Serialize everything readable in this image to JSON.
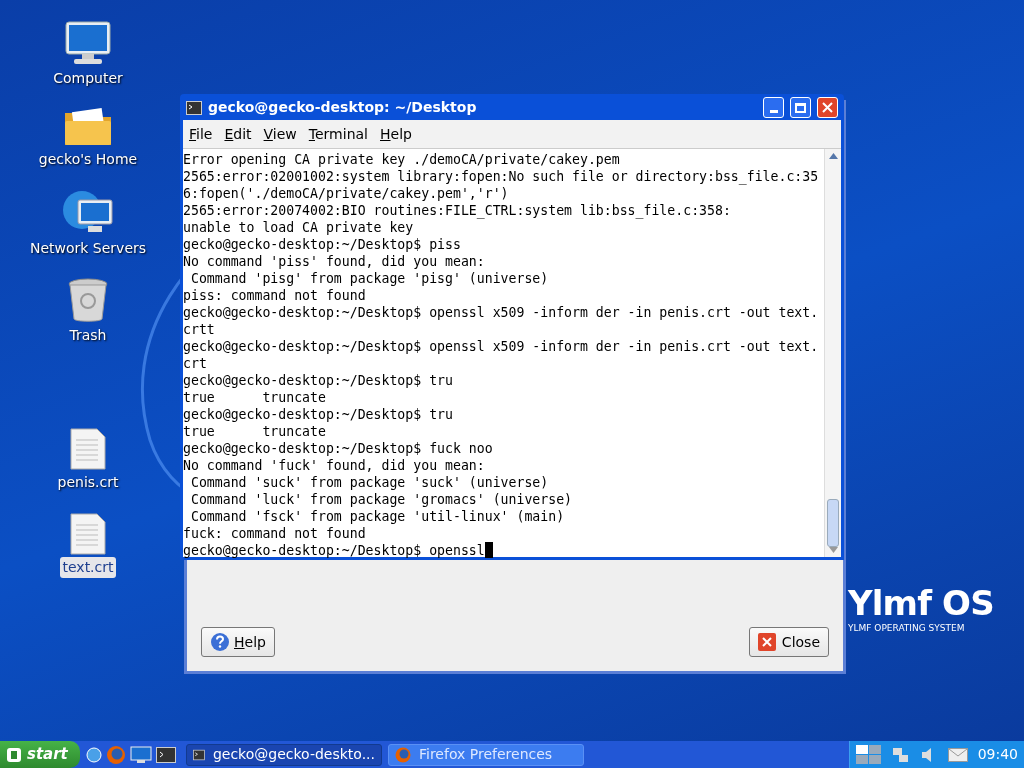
{
  "desktop_icons": [
    {
      "kind": "computer",
      "label": "Computer",
      "selected": false
    },
    {
      "kind": "folder",
      "label": "gecko's Home",
      "selected": false
    },
    {
      "kind": "network",
      "label": "Network Servers",
      "selected": false
    },
    {
      "kind": "trash",
      "label": "Trash",
      "selected": false
    },
    {
      "kind": "file",
      "label": "penis.crt",
      "selected": false
    },
    {
      "kind": "file",
      "label": "text.crt",
      "selected": true
    }
  ],
  "terminal": {
    "title": "gecko@gecko-desktop: ~/Desktop",
    "menu": [
      "File",
      "Edit",
      "View",
      "Terminal",
      "Help"
    ],
    "lines": [
      "Error opening CA private key ./demoCA/private/cakey.pem",
      "2565:error:02001002:system library:fopen:No such file or directory:bss_file.c:35",
      "6:fopen('./demoCA/private/cakey.pem','r')",
      "2565:error:20074002:BIO routines:FILE_CTRL:system lib:bss_file.c:358:",
      "unable to load CA private key",
      "gecko@gecko-desktop:~/Desktop$ piss",
      "No command 'piss' found, did you mean:",
      " Command 'pisg' from package 'pisg' (universe)",
      "piss: command not found",
      "gecko@gecko-desktop:~/Desktop$ openssl x509 -inform der -in penis.crt -out text.",
      "crtt",
      "gecko@gecko-desktop:~/Desktop$ openssl x509 -inform der -in penis.crt -out text.",
      "crt",
      "gecko@gecko-desktop:~/Desktop$ tru",
      "true      truncate",
      "gecko@gecko-desktop:~/Desktop$ tru",
      "true      truncate",
      "gecko@gecko-desktop:~/Desktop$ fuck noo",
      "No command 'fuck' found, did you mean:",
      " Command 'suck' from package 'suck' (universe)",
      " Command 'luck' from package 'gromacs' (universe)",
      " Command 'fsck' from package 'util-linux' (main)",
      "fuck: command not found",
      "gecko@gecko-desktop:~/Desktop$ openssl"
    ]
  },
  "dialog": {
    "help_button": "Help",
    "close_button": "Close"
  },
  "logo": {
    "name": "Ylmf OS",
    "tagline": "YLMF OPERATING SYSTEM"
  },
  "taskbar": {
    "start": "start",
    "tasks": [
      {
        "label": "gecko@gecko-deskto...",
        "kind": "terminal",
        "selected": true
      },
      {
        "label": "Firefox Preferences",
        "kind": "firefox",
        "selected": false
      }
    ],
    "clock": "09:40"
  }
}
